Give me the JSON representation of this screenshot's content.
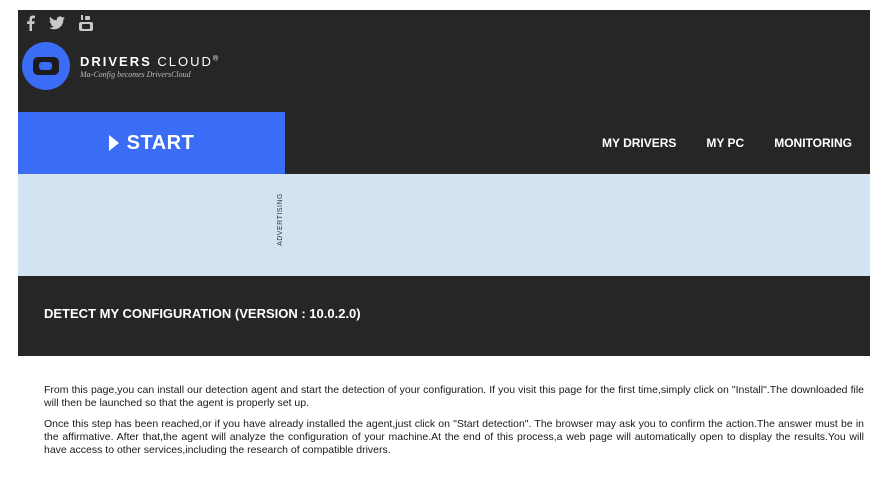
{
  "social": {
    "icons": [
      "facebook-icon",
      "twitter-icon",
      "youtube-icon"
    ]
  },
  "brand": {
    "name_bold": "DRIVERS",
    "name_light": "CLOUD",
    "name_mark": "®",
    "tagline": "Ma-Config becomes DriversCloud"
  },
  "nav": {
    "start_label": "START",
    "items": [
      "MY DRIVERS",
      "MY PC",
      "MONITORING"
    ]
  },
  "ad": {
    "label": "ADVERTISING"
  },
  "section": {
    "title": "DETECT MY CONFIGURATION (VERSION : 10.0.2.0)"
  },
  "content": {
    "paragraphs": [
      "From this page,you can install our detection agent and start the detection of your configuration. If you visit this page for the first time,simply click on \"Install\".The downloaded file will then be launched so that the agent is properly set up.",
      "Once this step has been reached,or if you have already installed the agent,just click on \"Start detection\". The browser may ask you to confirm the action.The answer must be in the affirmative. After that,the agent will analyze the configuration of your machine.At the end of this process,a web page will automatically open to display the results.You will have access to other services,including the research of compatible drivers."
    ]
  },
  "colors": {
    "accent": "#3b6cf5",
    "header_bg": "#262626",
    "ad_bg": "#d4e3f2"
  }
}
